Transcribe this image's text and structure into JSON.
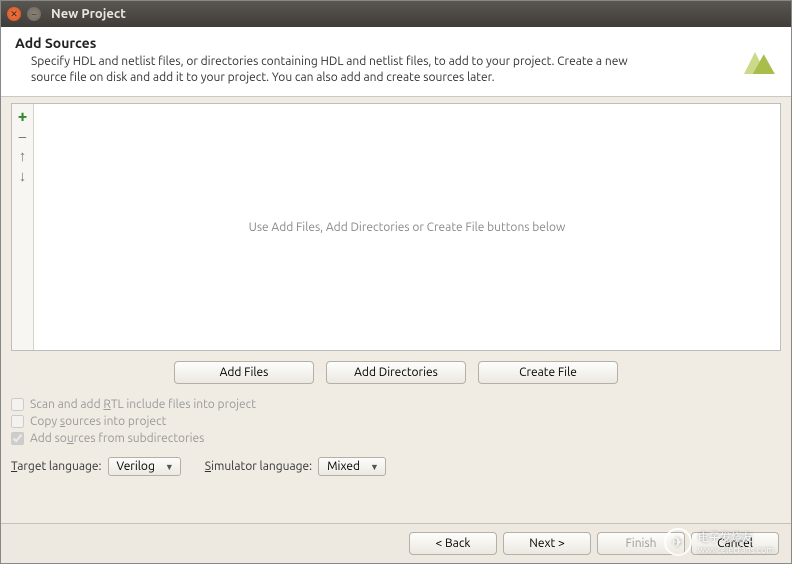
{
  "window": {
    "title": "New Project"
  },
  "header": {
    "title": "Add Sources",
    "description": "Specify HDL and netlist files, or directories containing HDL and netlist files, to add to your project. Create a new source file on disk and add it to your project. You can also add and create sources later."
  },
  "file_area": {
    "empty_message": "Use Add Files, Add Directories or Create File buttons below"
  },
  "buttons": {
    "add_files": "Add Files",
    "add_directories": "Add Directories",
    "create_file": "Create File"
  },
  "checkboxes": {
    "scan_include": {
      "label_pre": "Scan and add ",
      "label_u": "R",
      "label_post": "TL include files into project",
      "checked": false,
      "enabled": false
    },
    "copy_sources": {
      "label_pre": "Copy ",
      "label_u": "s",
      "label_post": "ources into project",
      "checked": false,
      "enabled": false
    },
    "add_subdirs": {
      "label_pre": "Add so",
      "label_u": "u",
      "label_post": "rces from subdirectories",
      "checked": true,
      "enabled": false
    }
  },
  "language": {
    "target_label_pre": "",
    "target_label_u": "T",
    "target_label_post": "arget language:",
    "target_value": "Verilog",
    "sim_label_pre": "",
    "sim_label_u": "S",
    "sim_label_post": "imulator language:",
    "sim_value": "Mixed"
  },
  "footer": {
    "back": "< Back",
    "next": "Next >",
    "finish": "Finish",
    "cancel": "Cancel"
  },
  "watermark": {
    "text1": "电子发烧友",
    "text2": "www.elecfans.com"
  }
}
